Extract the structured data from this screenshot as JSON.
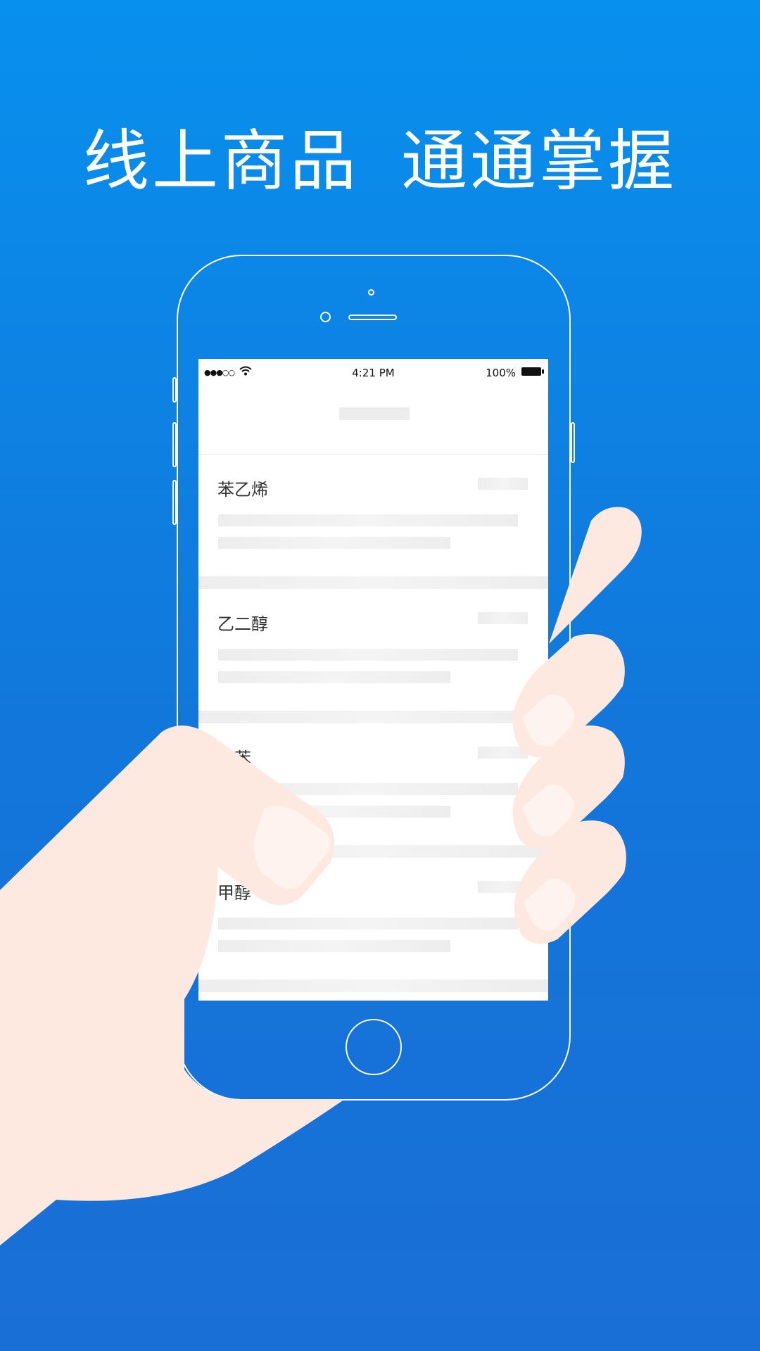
{
  "headline": {
    "part1": "线上商品",
    "part2": "通通掌握"
  },
  "statusbar": {
    "signal": "●●●○○",
    "time": "4:21 PM",
    "battery": "100%"
  },
  "items": [
    {
      "name": "苯乙烯"
    },
    {
      "name": "乙二醇"
    },
    {
      "name": "甲苯"
    },
    {
      "name": "甲醇"
    }
  ],
  "colors": {
    "background_top": "#0890ee",
    "background_bottom": "#1a6fd6",
    "skin": "#fde9e0",
    "nail": "#fff3ef"
  }
}
